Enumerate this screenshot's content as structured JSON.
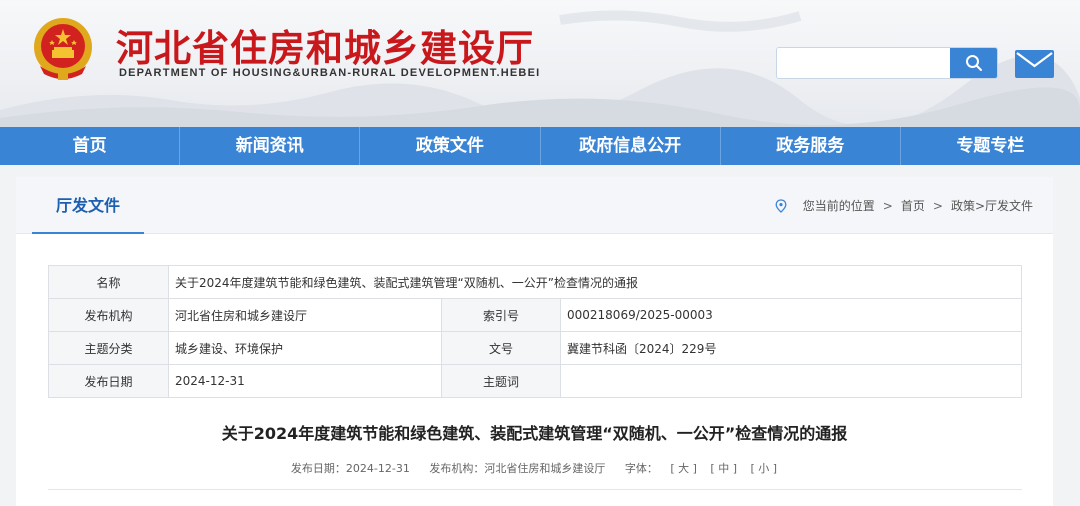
{
  "header": {
    "title": "河北省住房和城乡建设厅",
    "subtitle": "DEPARTMENT OF HOUSING&URBAN-RURAL DEVELOPMENT.HEBEI",
    "search_placeholder": "",
    "brand_color": "#c8181c",
    "accent_color": "#3a84d6"
  },
  "nav": {
    "items": [
      "首页",
      "新闻资讯",
      "政策文件",
      "政府信息公开",
      "政务服务",
      "专题专栏"
    ]
  },
  "panel": {
    "title": "厅发文件",
    "breadcrumb": {
      "label": "您当前的位置",
      "items": [
        "首页",
        "政策>厅发文件"
      ]
    }
  },
  "meta": {
    "name_label": "名称",
    "name_value": "关于2024年度建筑节能和绿色建筑、装配式建筑管理“双随机、一公开”检查情况的通报",
    "issuer_label": "发布机构",
    "issuer_value": "河北省住房和城乡建设厅",
    "index_label": "索引号",
    "index_value": "000218069/2025-00003",
    "topic_label": "主题分类",
    "topic_value": "城乡建设、环境保护",
    "docno_label": "文号",
    "docno_value": "冀建节科函〔2024〕229号",
    "date_label": "发布日期",
    "date_value": "2024-12-31",
    "keywords_label": "主题词",
    "keywords_value": ""
  },
  "article": {
    "title": "关于2024年度建筑节能和绿色建筑、装配式建筑管理“双随机、一公开”检查情况的通报",
    "date_text": "发布日期：2024-12-31",
    "issuer_text": "发布机构：河北省住房和城乡建设厅",
    "font_label": "字体：",
    "font_large": "[ 大 ]",
    "font_medium": "[ 中 ]",
    "font_small": "[ 小 ]"
  }
}
